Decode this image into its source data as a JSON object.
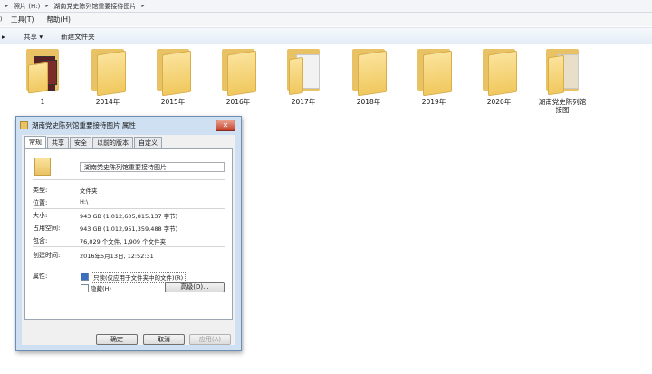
{
  "address_bar": {
    "crumbs": [
      "照片 (H:)",
      "湖南党史陈列馆重要接待图片"
    ]
  },
  "menu": {
    "items": [
      "工具(T)",
      "帮助(H)"
    ]
  },
  "toolbar": {
    "share": "共享 ▾",
    "new_folder": "新建文件夹"
  },
  "folders": [
    "1",
    "2014年",
    "2015年",
    "2016年",
    "2017年",
    "2018年",
    "2019年",
    "2020年",
    "湖南党史陈列馆\n接图"
  ],
  "dialog": {
    "title": "湖南党史陈列馆重要接待图片 属性",
    "close": "✕",
    "tabs": [
      "常规",
      "共享",
      "安全",
      "以前的版本",
      "自定义"
    ],
    "folder_name": "湖南党史陈列馆重要接待图片",
    "type_label": "类型:",
    "type_value": "文件夹",
    "location_label": "位置:",
    "location_value": "H:\\",
    "size_label": "大小:",
    "size_value": "943 GB (1,012,605,815,137 字节)",
    "size_on_disk_label": "占用空间:",
    "size_on_disk_value": "943 GB (1,012,951,359,488 字节)",
    "contains_label": "包含:",
    "contains_value": "76,029 个文件, 1,909 个文件夹",
    "created_label": "创建时间:",
    "created_value": "2016年5月13日, 12:52:31",
    "attributes_label": "属性:",
    "readonly_label": "只读(仅应用于文件夹中的文件)(R)",
    "hidden_label": "隐藏(H)",
    "advanced_button": "高级(D)...",
    "ok": "确定",
    "cancel": "取消",
    "apply": "应用(A)"
  }
}
